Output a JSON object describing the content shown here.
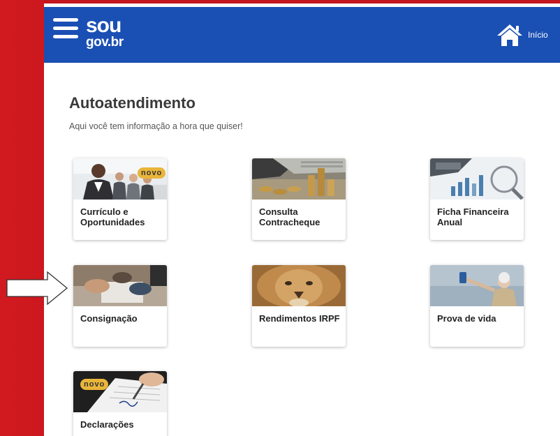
{
  "header": {
    "logo_top": "sou",
    "logo_bottom": "gov.br",
    "home_label": "Início"
  },
  "page": {
    "title": "Autoatendimento",
    "subtitle": "Aqui você tem informação a hora que quiser!"
  },
  "cards": [
    {
      "label": "Currículo e Oportunidades",
      "badge": "novo"
    },
    {
      "label": "Consulta Contracheque"
    },
    {
      "label": "Ficha Financeira Anual"
    },
    {
      "label": "Consignação"
    },
    {
      "label": "Rendimentos IRPF"
    },
    {
      "label": "Prova de vida"
    },
    {
      "label": "Declarações",
      "badge": "novo"
    }
  ],
  "colors": {
    "header": "#1a4fb3",
    "slide_background": "#c0141a",
    "badge": "#e9b53a"
  }
}
